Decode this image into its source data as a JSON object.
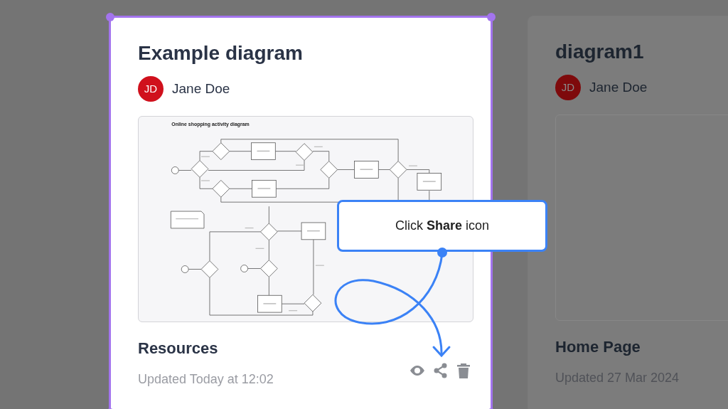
{
  "cards": [
    {
      "title": "Example diagram",
      "selected": true,
      "avatar": {
        "initials": "JD"
      },
      "owner": "Jane Doe",
      "thumbnail": {
        "kind": "diagram",
        "title": "Online shopping activity diagram"
      },
      "folder": "Resources",
      "updated": "Updated Today at 12:02"
    },
    {
      "title": "diagram1",
      "selected": false,
      "avatar": {
        "initials": "JD"
      },
      "owner": "Jane Doe",
      "thumbnail": {
        "kind": "empty"
      },
      "folder": "Home Page",
      "updated": "Updated 27 Mar 2024"
    }
  ],
  "callout": {
    "text": "Click **Share** icon"
  }
}
